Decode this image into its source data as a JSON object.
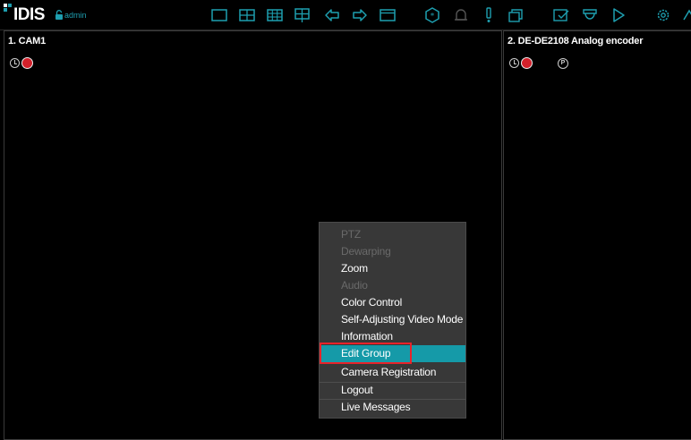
{
  "app": {
    "logo_text": "IDIS",
    "user": "admin"
  },
  "toolbar": {
    "icons": [
      "single-view-icon",
      "quad-view-icon",
      "nine-split-view-icon",
      "custom-layout-icon",
      "previous-group-icon",
      "next-group-icon",
      "fullscreen-icon",
      "event-monitoring-icon",
      "alarm-bell-icon",
      "alert-icon",
      "sequence-icon",
      "status-check-icon",
      "camera-icon",
      "playback-icon",
      "settings-icon"
    ]
  },
  "cameras": [
    {
      "title": "1. CAM1"
    },
    {
      "title": "2. DE-DE2108 Analog encoder",
      "badge": "P"
    }
  ],
  "context_menu": {
    "items": [
      {
        "label": "PTZ",
        "enabled": false
      },
      {
        "label": "Dewarping",
        "enabled": false
      },
      {
        "label": "Zoom",
        "enabled": true
      },
      {
        "label": "Audio",
        "enabled": false
      },
      {
        "label": "Color Control",
        "enabled": true
      },
      {
        "label": "Self-Adjusting Video Mode",
        "enabled": true
      },
      {
        "label": "Information",
        "enabled": true
      },
      {
        "label": "Edit Group",
        "enabled": true,
        "selected": true
      },
      {
        "label": "Camera Registration",
        "enabled": true
      },
      {
        "label": "Logout",
        "enabled": true
      },
      {
        "label": "Live Messages",
        "enabled": true
      }
    ]
  },
  "colors": {
    "accent": "#159aa8",
    "record": "#d2202a",
    "highlight_box": "#e8232a",
    "menu_bg": "#383838",
    "disabled_text": "#6a6a6a"
  }
}
